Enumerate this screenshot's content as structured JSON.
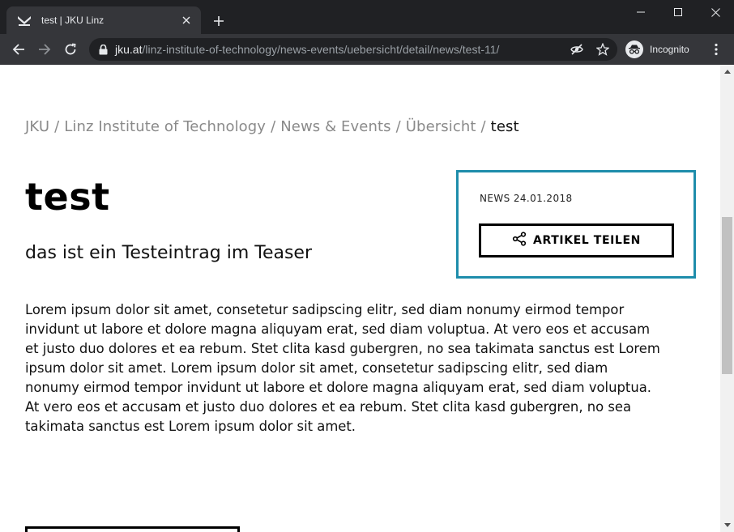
{
  "browser": {
    "tab_title": "test | JKU Linz",
    "url_host": "jku.at",
    "url_path": "/linz-institute-of-technology/news-events/uebersicht/detail/news/test-11/",
    "incognito_label": "Incognito"
  },
  "page": {
    "breadcrumb": [
      {
        "label": "JKU"
      },
      {
        "label": "Linz Institute of Technology"
      },
      {
        "label": "News & Events"
      },
      {
        "label": "Übersicht"
      }
    ],
    "breadcrumb_separator": "/",
    "breadcrumb_current": "test",
    "title": "test",
    "teaser": "das ist ein Testeintrag im Teaser",
    "body": "Lorem ipsum dolor sit amet, consetetur sadipscing elitr, sed diam nonumy eirmod tempor invidunt ut labore et dolore magna aliquyam erat, sed diam voluptua. At vero eos et accusam et justo duo dolores et ea rebum. Stet clita kasd gubergren, no sea takimata sanctus est Lorem ipsum dolor sit amet. Lorem ipsum dolor sit amet, consetetur sadipscing elitr, sed diam nonumy eirmod tempor invidunt ut labore et dolore magna aliquyam erat, sed diam voluptua. At vero eos et accusam et justo duo dolores et ea rebum. Stet clita kasd gubergren, no sea takimata sanctus est Lorem ipsum dolor sit amet.",
    "news_meta": "NEWS 24.01.2018",
    "share_label": "ARTIKEL TEILEN"
  },
  "colors": {
    "accent_border": "#1e8dab",
    "chrome_dark": "#202124",
    "chrome_toolbar": "#35363a"
  },
  "icons": [
    "jku-logo-icon",
    "close-icon",
    "plus-icon",
    "minimize-icon",
    "maximize-icon",
    "back-icon",
    "forward-icon",
    "reload-icon",
    "lock-icon",
    "eye-off-icon",
    "star-icon",
    "incognito-icon",
    "more-vert-icon",
    "share-icon"
  ]
}
